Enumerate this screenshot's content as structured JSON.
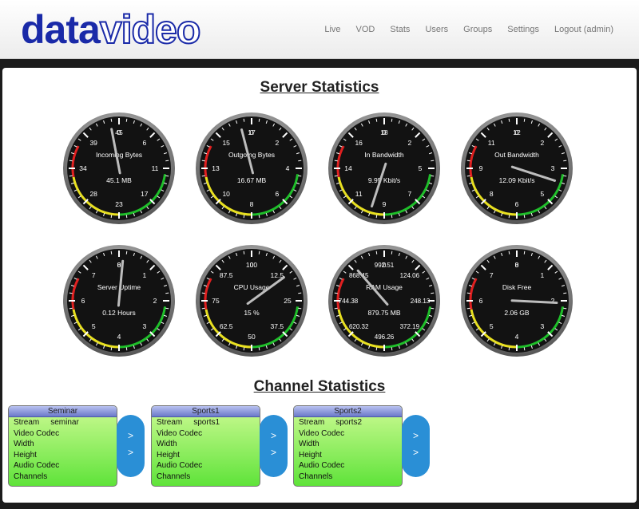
{
  "brand": {
    "part1": "data",
    "part2": "video"
  },
  "nav": [
    "Live",
    "VOD",
    "Stats",
    "Users",
    "Groups",
    "Settings",
    "Logout (admin)"
  ],
  "server_title": "Server Statistics",
  "channel_title": "Channel Statistics",
  "gauges": [
    {
      "label": "Incoming Bytes",
      "value_text": "45.1 MB",
      "ticks": [
        "0",
        "6",
        "11",
        "17",
        "23",
        "28",
        "34",
        "39",
        "45"
      ],
      "needle": 0.97
    },
    {
      "label": "Outgoing Bytes",
      "value_text": "16.67 MB",
      "ticks": [
        "0",
        "2",
        "4",
        "6",
        "8",
        "10",
        "13",
        "15",
        "17"
      ],
      "needle": 0.96
    },
    {
      "label": "In Bandwidth",
      "value_text": "9.95 Kbit/s",
      "ticks": [
        "0",
        "2",
        "5",
        "7",
        "9",
        "11",
        "14",
        "16",
        "18"
      ],
      "needle": 0.55
    },
    {
      "label": "Out Bandwidth",
      "value_text": "12.09 Kbit/s",
      "ticks": [
        "0",
        "2",
        "3",
        "5",
        "6",
        "8",
        "9",
        "11",
        "12"
      ],
      "needle": 0.3
    },
    {
      "label": "Server Uptime",
      "value_text": "0.12 Hours",
      "ticks": [
        "0",
        "1",
        "2",
        "3",
        "4",
        "5",
        "6",
        "7",
        "8"
      ],
      "needle": 0.015
    },
    {
      "label": "CPU Usage",
      "value_text": "15 %",
      "ticks": [
        "0",
        "12.5",
        "25",
        "37.5",
        "50",
        "62.5",
        "75",
        "87.5",
        "100"
      ],
      "needle": 0.15
    },
    {
      "label": "RAM Usage",
      "value_text": "879.75 MB",
      "ticks": [
        "0",
        "124.06",
        "248.13",
        "372.19",
        "496.26",
        "620.32",
        "744.38",
        "868.45",
        "992.51"
      ],
      "needle": 0.886
    },
    {
      "label": "Disk Free",
      "value_text": "2.06 GB",
      "ticks": [
        "0",
        "1",
        "2",
        "3",
        "4",
        "5",
        "6",
        "7",
        "8"
      ],
      "needle": 0.258
    }
  ],
  "channels": [
    {
      "name": "Seminar",
      "stream_label": "Stream",
      "stream": "seminar",
      "rows": [
        "Video Codec",
        "Width",
        "Height",
        "Audio Codec",
        "Channels"
      ]
    },
    {
      "name": "Sports1",
      "stream_label": "Stream",
      "stream": "sports1",
      "rows": [
        "Video Codec",
        "Width",
        "Height",
        "Audio Codec",
        "Channels"
      ]
    },
    {
      "name": "Sports2",
      "stream_label": "Stream",
      "stream": "sports2",
      "rows": [
        "Video Codec",
        "Width",
        "Height",
        "Audio Codec",
        "Channels"
      ]
    }
  ],
  "button_glyphs": [
    ">",
    ">"
  ],
  "colors": {
    "brand_blue": "#1a2aa8",
    "button_blue": "#2a8fd6",
    "card_green": "#5fe33a",
    "card_header": "#6b79c9"
  }
}
